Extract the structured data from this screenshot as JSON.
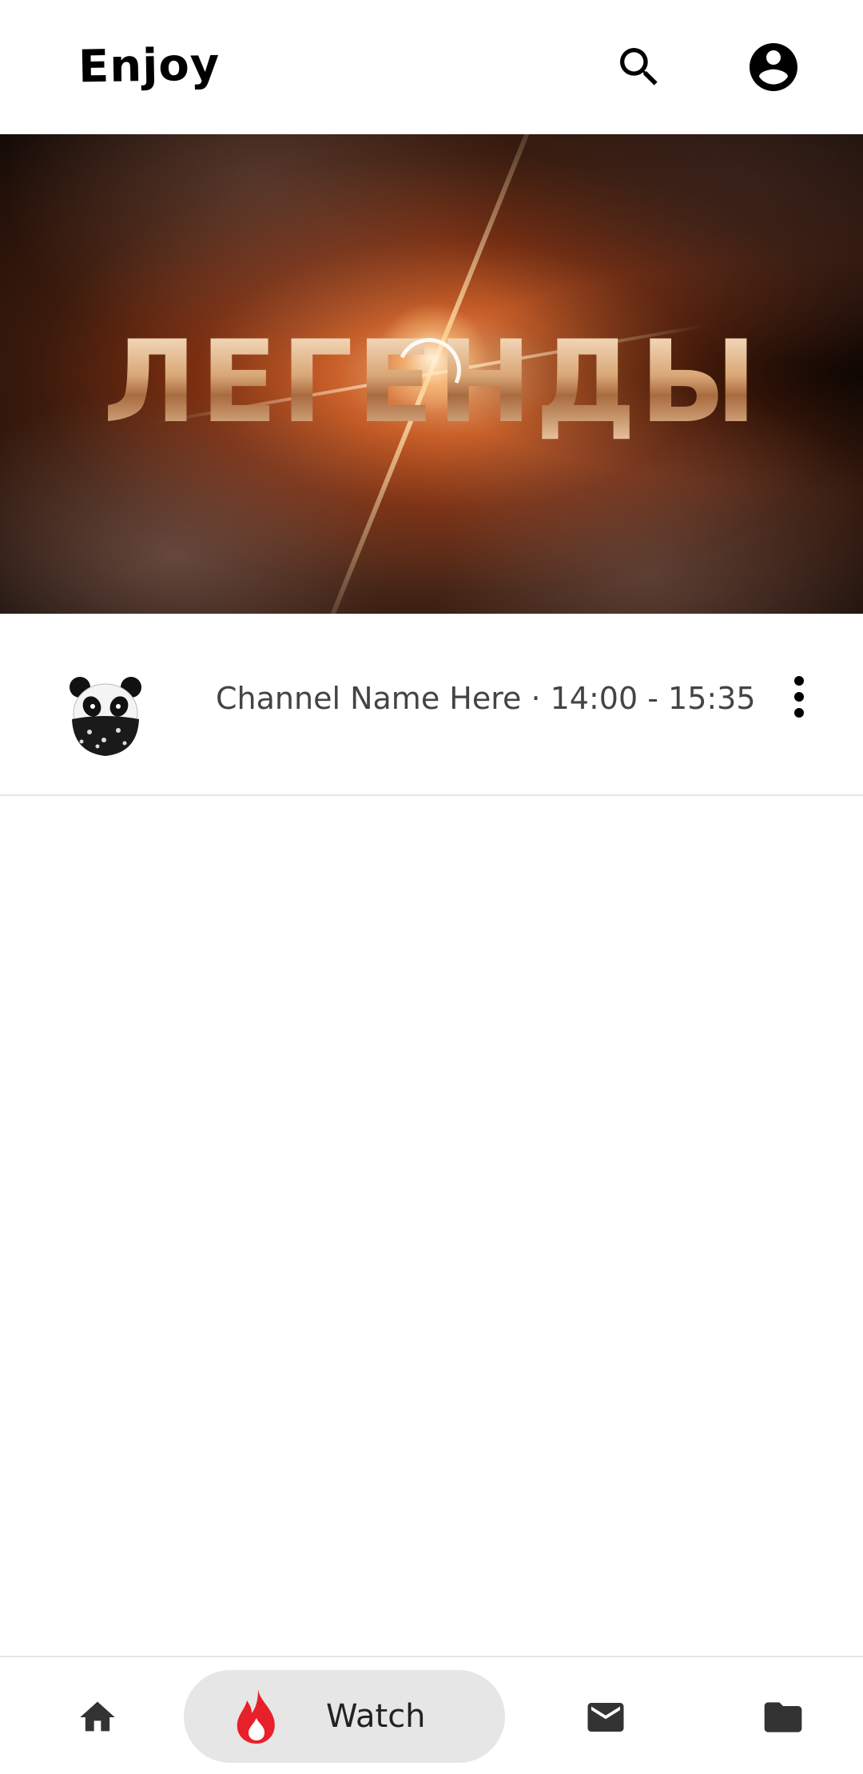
{
  "app": {
    "brand": "Enjoy"
  },
  "topbar": {
    "icons": [
      "search-icon",
      "account-circle-icon"
    ]
  },
  "player": {
    "title_overlay": "ЛЕГЕНДЫ",
    "state": "loading"
  },
  "channel": {
    "line": "Channel Name Here · 14:00 - 15:35",
    "avatar": "panda-avatar",
    "more_icon": "more-vert-icon"
  },
  "bottom_nav": {
    "items": [
      {
        "icon": "home-icon",
        "label": ""
      },
      {
        "icon": "fire-icon",
        "label": "Watch",
        "active": true
      },
      {
        "icon": "mail-icon",
        "label": ""
      },
      {
        "icon": "folder-icon",
        "label": ""
      }
    ]
  },
  "colors": {
    "accent_fire": "#e8202a",
    "active_pill": "#e6e6e6",
    "icon": "#333333"
  }
}
